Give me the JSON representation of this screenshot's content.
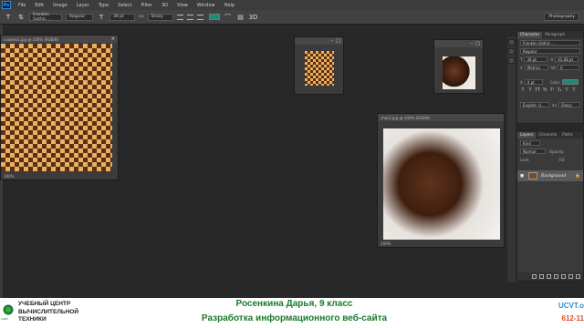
{
  "app": {
    "logo_text": "Ps"
  },
  "menu": [
    "File",
    "Edit",
    "Image",
    "Layer",
    "Type",
    "Select",
    "Filter",
    "3D",
    "View",
    "Window",
    "Help"
  ],
  "options": {
    "font_family": "Franklin Gothic ...",
    "font_style": "Regular",
    "font_size": "36 pt",
    "antialias": "Sharp",
    "color": "#1d8a78",
    "workspace": "Photography"
  },
  "docs": {
    "checker": {
      "title": "cookies1.jpg @ 100% (RGB/8)",
      "zoom": "100%",
      "close": "✕"
    },
    "small1": {
      "title": "",
      "zoom": ""
    },
    "small2": {
      "title": "",
      "zoom": ""
    },
    "main": {
      "title": "choc1.jpg @ 100% (RGB/8)",
      "zoom": "100%"
    }
  },
  "character_panel": {
    "tabs": [
      "Character",
      "Paragraph"
    ],
    "font_family": "Franklin Gothic ...",
    "font_style": "Regular",
    "size": "36 pt",
    "leading": "41,08 pt",
    "kerning": "Metrics",
    "tracking": "0",
    "scale": "0 pt",
    "color_label": "Color:",
    "language": "English: U...",
    "aa_mode": "Sharp",
    "tt_buttons": [
      "T",
      "T",
      "TT",
      "Tt",
      "T¹",
      "T₁",
      "T",
      "T"
    ]
  },
  "layers_panel": {
    "tabs": [
      "Layers",
      "Channels",
      "Paths"
    ],
    "kind": "Kind",
    "blend_mode": "Normal",
    "opacity_label": "Opacity:",
    "lock_label": "Lock:",
    "fill_label": "Fill:",
    "layer_name": "Background",
    "eye_icon": "●",
    "lock_icon": "🔒"
  },
  "banner": {
    "org_line1": "УЧЕБНЫЙ ЦЕНТР",
    "org_line2": "ВЫЧИСЛИТЕЛЬНОЙ",
    "org_line3": "ТЕХНИКИ",
    "logo_sub": "УЦВТ",
    "title_line1": "Росенкина Дарья, 9 класс",
    "title_line2": "Разработка информационного веб-сайта",
    "site": "UCVT.o",
    "phone": "612-11"
  }
}
